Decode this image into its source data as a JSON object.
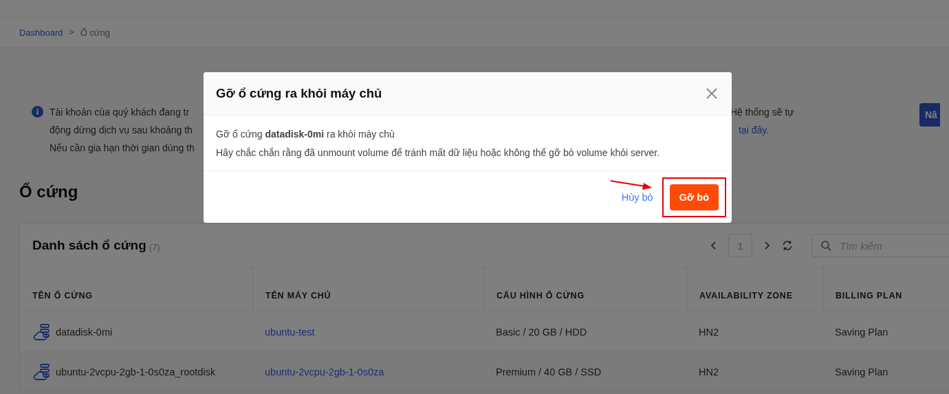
{
  "breadcrumb": [
    {
      "label": "Dashboard",
      "link": true
    },
    {
      "label": "Ổ cứng",
      "link": false
    }
  ],
  "breadcrumb_separator": ">",
  "notice": {
    "left_lines": [
      "Tài khoản của quý khách đang tr",
      "động dừng dịch vụ sau khoảng th",
      "Nếu cần gia hạn thời gian dùng th"
    ],
    "right_line_1": "Hệ thống sẽ tự",
    "right_link": "tại đây.",
    "button": "Nâ"
  },
  "page_title": "Ổ cứng",
  "card": {
    "title": "Danh sách ổ cứng",
    "count": "(7)",
    "page": "1",
    "search": {
      "placeholder": "Tìm kiếm"
    }
  },
  "table": {
    "columns": [
      "TÊN Ổ CỨNG",
      "TÊN MÁY CHỦ",
      "CẤU HÌNH Ổ CỨNG",
      "AVAILABILITY ZONE",
      "BILLING PLAN"
    ],
    "rows": [
      {
        "name": "datadisk-0mi",
        "server": "ubuntu-test",
        "config": "Basic / 20 GB / HDD",
        "zone": "HN2",
        "plan": "Saving Plan"
      },
      {
        "name": "ubuntu-2vcpu-2gb-1-0s0za_rootdisk",
        "server": "ubuntu-2vcpu-2gb-1-0s0za",
        "config": "Premium / 40 GB / SSD",
        "zone": "HN2",
        "plan": "Saving Plan"
      }
    ]
  },
  "dialog": {
    "title": "Gỡ ổ cứng ra khỏi máy chủ",
    "message": "Gỡ ổ cứng **datadisk-0mi** ra khỏi máy chủ",
    "warning": "Hãy chắc chắn rằng đã unmount volume để tránh mất dữ liệu hoặc không thể gỡ bỏ volume khỏi server.",
    "cancel": "Hủy bỏ",
    "confirm": "Gỡ bỏ",
    "confirm_highlighted": true
  }
}
